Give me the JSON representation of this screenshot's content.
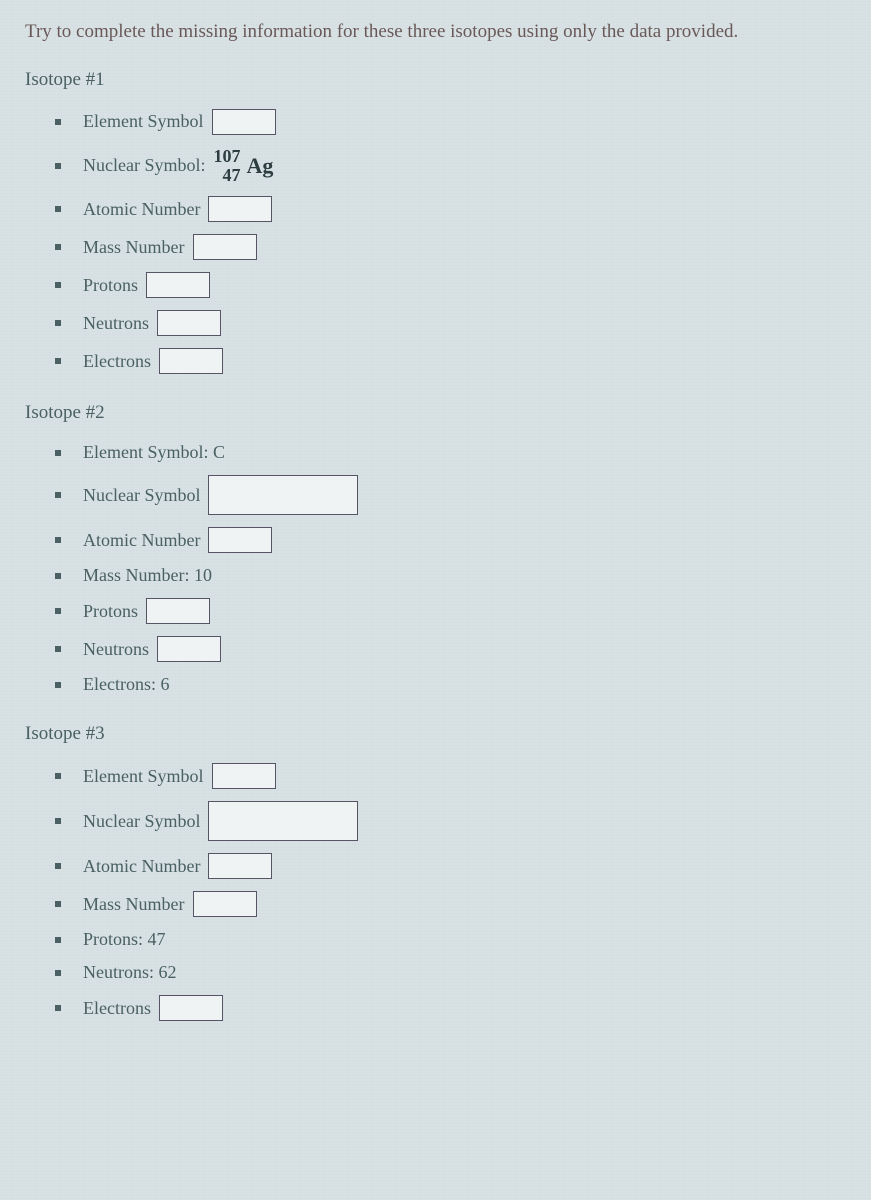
{
  "instruction": "Try to complete the missing information for these three isotopes using only the data provided.",
  "isotopes": [
    {
      "header": "Isotope #1",
      "fields": {
        "element_symbol_label": "Element Symbol",
        "nuclear_symbol_label": "Nuclear Symbol:",
        "nuclear_mass": "107",
        "nuclear_z": "47",
        "nuclear_elem": "Ag",
        "atomic_number_label": "Atomic Number",
        "mass_number_label": "Mass Number",
        "protons_label": "Protons",
        "neutrons_label": "Neutrons",
        "electrons_label": "Electrons"
      }
    },
    {
      "header": "Isotope #2",
      "fields": {
        "element_symbol_label": "Element Symbol: C",
        "nuclear_symbol_label": "Nuclear Symbol",
        "atomic_number_label": "Atomic Number",
        "mass_number_label": "Mass Number: 10",
        "protons_label": "Protons",
        "neutrons_label": "Neutrons",
        "electrons_label": "Electrons: 6"
      }
    },
    {
      "header": "Isotope #3",
      "fields": {
        "element_symbol_label": "Element Symbol",
        "nuclear_symbol_label": "Nuclear Symbol",
        "atomic_number_label": "Atomic Number",
        "mass_number_label": "Mass Number",
        "protons_label": "Protons: 47",
        "neutrons_label": "Neutrons: 62",
        "electrons_label": "Electrons"
      }
    }
  ]
}
